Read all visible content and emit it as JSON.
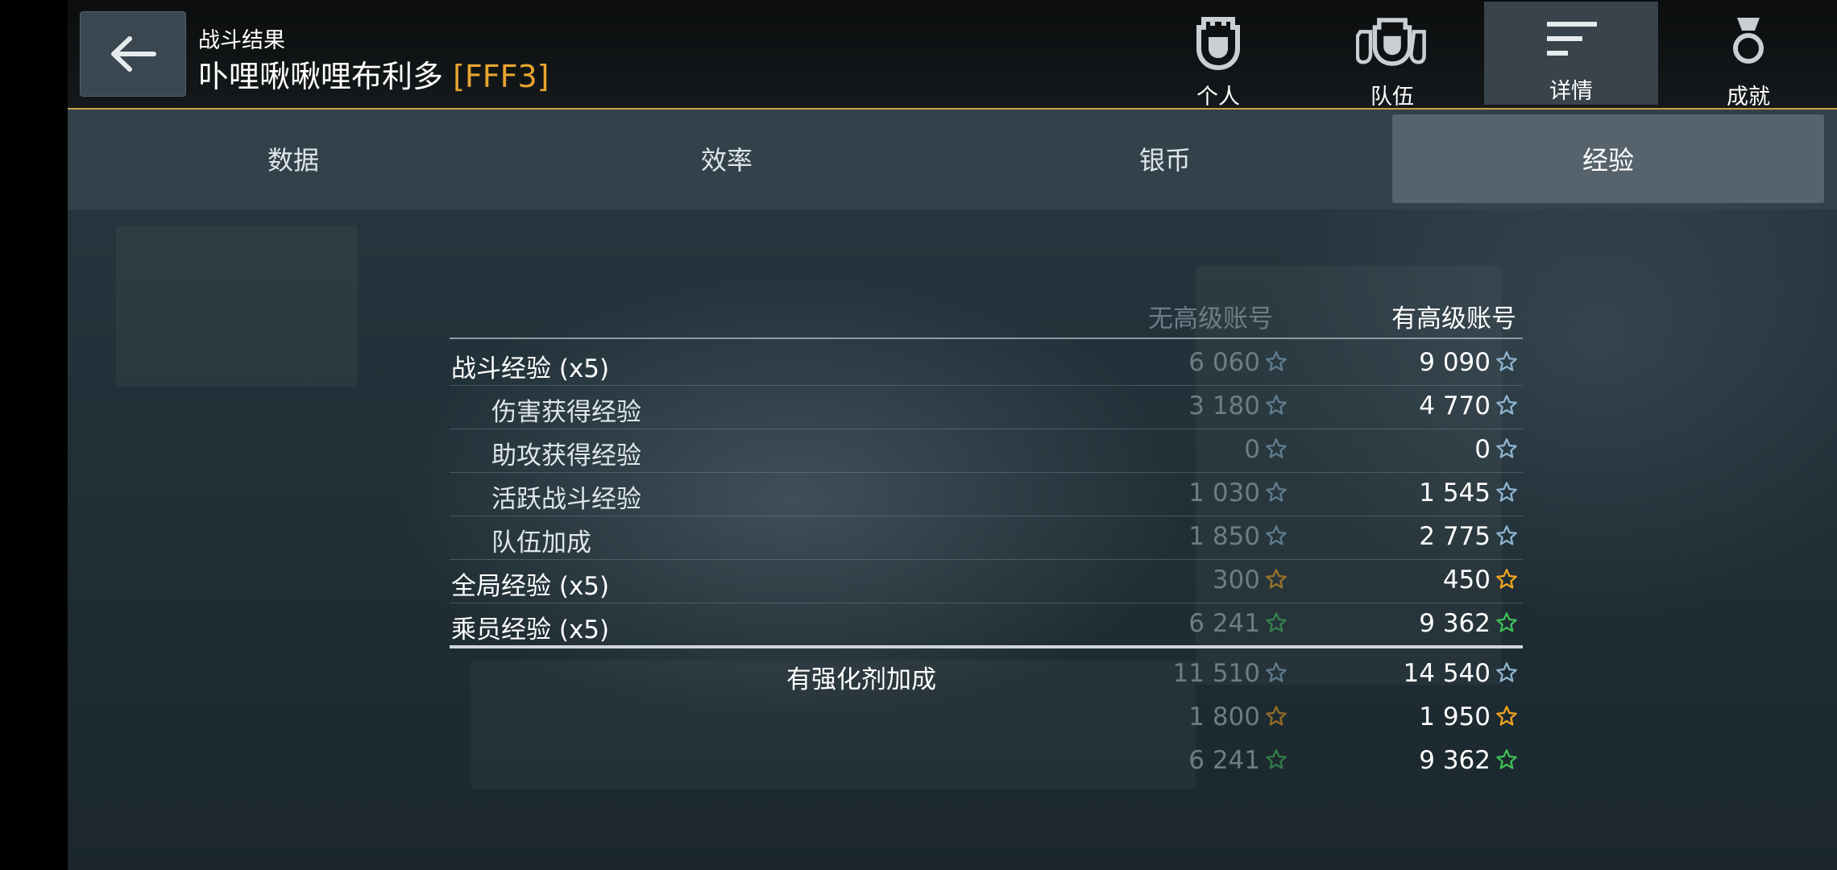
{
  "header": {
    "subtitle": "战斗结果",
    "player_name": "卟哩啾啾哩布利多",
    "clan_tag": "[FFF3]"
  },
  "top_tabs": [
    {
      "label": "个人",
      "icon": "helmet-icon",
      "active": false
    },
    {
      "label": "队伍",
      "icon": "team-helmets-icon",
      "active": false
    },
    {
      "label": "详情",
      "icon": "details-lines-icon",
      "active": true
    },
    {
      "label": "成就",
      "icon": "medal-icon",
      "active": false
    }
  ],
  "sub_tabs": [
    {
      "label": "数据",
      "active": false
    },
    {
      "label": "效率",
      "active": false
    },
    {
      "label": "银币",
      "active": false
    },
    {
      "label": "经验",
      "active": true
    }
  ],
  "table": {
    "col_no_premium": "无高级账号",
    "col_premium": "有高级账号",
    "rows": [
      {
        "label": "战斗经验 (x5)",
        "indent": false,
        "no_premium": "6 060",
        "premium": "9 090",
        "star": "blue"
      },
      {
        "label": "伤害获得经验",
        "indent": true,
        "no_premium": "3 180",
        "premium": "4 770",
        "star": "blue"
      },
      {
        "label": "助攻获得经验",
        "indent": true,
        "no_premium": "0",
        "premium": "0",
        "star": "blue"
      },
      {
        "label": "活跃战斗经验",
        "indent": true,
        "no_premium": "1 030",
        "premium": "1 545",
        "star": "blue"
      },
      {
        "label": "队伍加成",
        "indent": true,
        "no_premium": "1 850",
        "premium": "2 775",
        "star": "blue"
      },
      {
        "label": "全局经验 (x5)",
        "indent": false,
        "no_premium": "300",
        "premium": "450",
        "star": "gold"
      },
      {
        "label": "乘员经验 (x5)",
        "indent": false,
        "no_premium": "6 241",
        "premium": "9 362",
        "star": "green"
      }
    ],
    "totals_label": "有强化剂加成",
    "totals": [
      {
        "no_premium": "11 510",
        "premium": "14 540",
        "star": "blue"
      },
      {
        "no_premium": "1 800",
        "premium": "1 950",
        "star": "gold"
      },
      {
        "no_premium": "6 241",
        "premium": "9 362",
        "star": "green"
      }
    ]
  },
  "colors": {
    "accent_gold": "#c7a24a",
    "clan_tag": "#e8a531",
    "star_blue": "#8fb4cf",
    "star_gold": "#f2a51f",
    "star_green": "#3fbf55"
  }
}
